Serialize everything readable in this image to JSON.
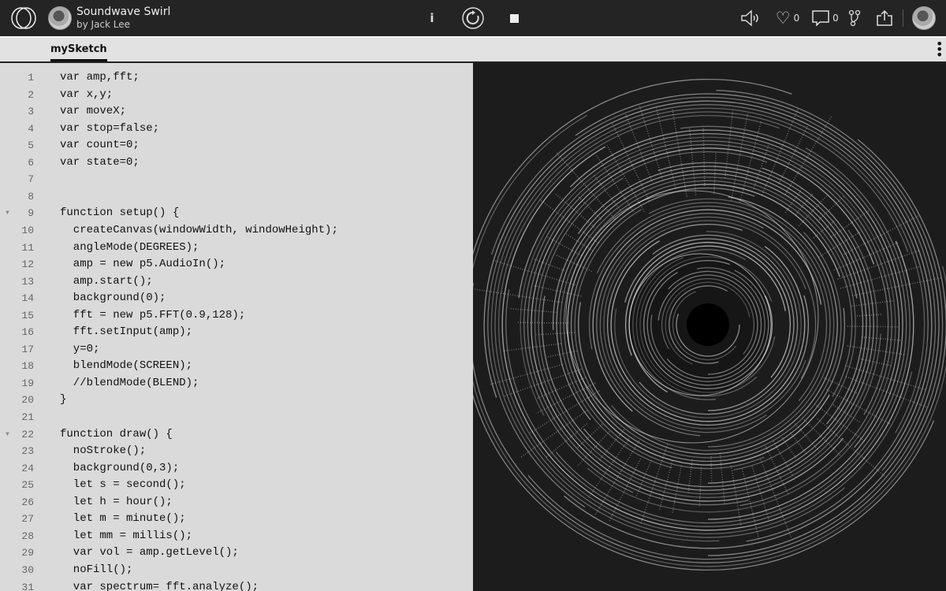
{
  "header": {
    "title": "Soundwave Swirl",
    "author": "by Jack Lee",
    "info_label": "i",
    "like_count": "0",
    "comment_count": "0"
  },
  "tabs": [
    {
      "label": "mySketch"
    }
  ],
  "editor": {
    "lines": [
      "var amp,fft;",
      "var x,y;",
      "var moveX;",
      "var stop=false;",
      "var count=0;",
      "var state=0;",
      "",
      "",
      "function setup() {",
      "  createCanvas(windowWidth, windowHeight);",
      "  angleMode(DEGREES);",
      "  amp = new p5.AudioIn();",
      "  amp.start();",
      "  background(0);",
      "  fft = new p5.FFT(0.9,128);",
      "  fft.setInput(amp);",
      "  y=0;",
      "  blendMode(SCREEN);",
      "  //blendMode(BLEND);",
      "}",
      "",
      "function draw() {",
      "  noStroke();",
      "  background(0,3);",
      "  let s = second();",
      "  let h = hour();",
      "  let m = minute();",
      "  let mm = millis();",
      "  var vol = amp.getLevel();",
      "  noFill();",
      "  var spectrum= fft.analyze();"
    ],
    "fold_lines": [
      9,
      22
    ]
  }
}
